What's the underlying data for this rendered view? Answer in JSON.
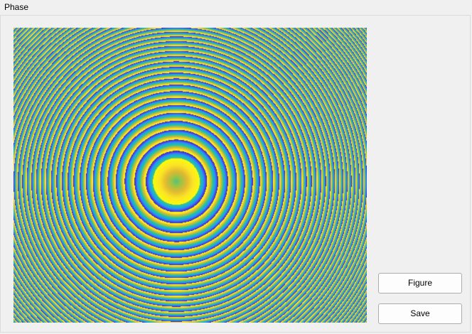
{
  "panel": {
    "title": "Phase"
  },
  "plot": {
    "colormap": [
      "#3e26a8",
      "#4748f5",
      "#2d8ff2",
      "#16b4d1",
      "#2ebf9f",
      "#8fc54a",
      "#e0b932",
      "#fde425",
      "#f9fb0e"
    ],
    "ring_center_ratio": [
      0.46,
      0.52
    ],
    "ring_spacing_ratio": 0.066
  },
  "buttons": {
    "figure_label": "Figure",
    "save_label": "Save"
  }
}
